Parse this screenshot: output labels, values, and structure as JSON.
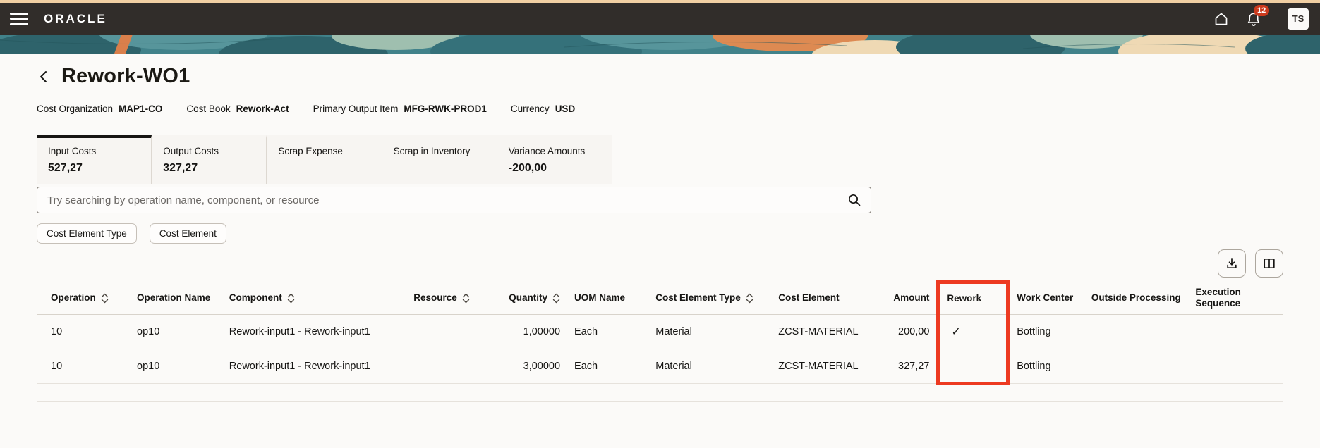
{
  "header": {
    "brand": "ORACLE",
    "notification_count": "12",
    "avatar_initials": "TS"
  },
  "page": {
    "title": "Rework-WO1"
  },
  "context": {
    "items": [
      {
        "label": "Cost Organization",
        "value": "MAP1-CO"
      },
      {
        "label": "Cost Book",
        "value": "Rework-Act"
      },
      {
        "label": "Primary Output Item",
        "value": "MFG-RWK-PROD1"
      },
      {
        "label": "Currency",
        "value": "USD"
      }
    ]
  },
  "tabs": [
    {
      "label": "Input Costs",
      "value": "527,27",
      "selected": true
    },
    {
      "label": "Output Costs",
      "value": "327,27",
      "selected": false
    },
    {
      "label": "Scrap Expense",
      "value": "",
      "selected": false
    },
    {
      "label": "Scrap in Inventory",
      "value": "",
      "selected": false
    },
    {
      "label": "Variance Amounts",
      "value": "-200,00",
      "selected": false
    }
  ],
  "search": {
    "placeholder": "Try searching by operation name, component, or resource"
  },
  "filters": [
    {
      "label": "Cost Element Type"
    },
    {
      "label": "Cost Element"
    }
  ],
  "table": {
    "columns": {
      "operation": "Operation",
      "operation_name": "Operation Name",
      "component": "Component",
      "resource": "Resource",
      "quantity": "Quantity",
      "uom_name": "UOM Name",
      "cost_element_type": "Cost Element Type",
      "cost_element": "Cost Element",
      "amount": "Amount",
      "rework": "Rework",
      "work_center": "Work Center",
      "outside_processing": "Outside Processing",
      "execution_sequence": "Execution Sequence"
    },
    "rows": [
      {
        "operation": "10",
        "operation_name": "op10",
        "component": "Rework-input1 - Rework-input1",
        "resource": "",
        "quantity": "1,00000",
        "uom_name": "Each",
        "cost_element_type": "Material",
        "cost_element": "ZCST-MATERIAL",
        "amount": "200,00",
        "rework": "✓",
        "work_center": "Bottling",
        "outside_processing": "",
        "execution_sequence": ""
      },
      {
        "operation": "10",
        "operation_name": "op10",
        "component": "Rework-input1 - Rework-input1",
        "resource": "",
        "quantity": "3,00000",
        "uom_name": "Each",
        "cost_element_type": "Material",
        "cost_element": "ZCST-MATERIAL",
        "amount": "327,27",
        "rework": "",
        "work_center": "Bottling",
        "outside_processing": "",
        "execution_sequence": ""
      }
    ]
  },
  "colors": {
    "highlight_red": "#ED3A21",
    "badge_red": "#CB3A1D",
    "topbar": "#312D2A"
  }
}
